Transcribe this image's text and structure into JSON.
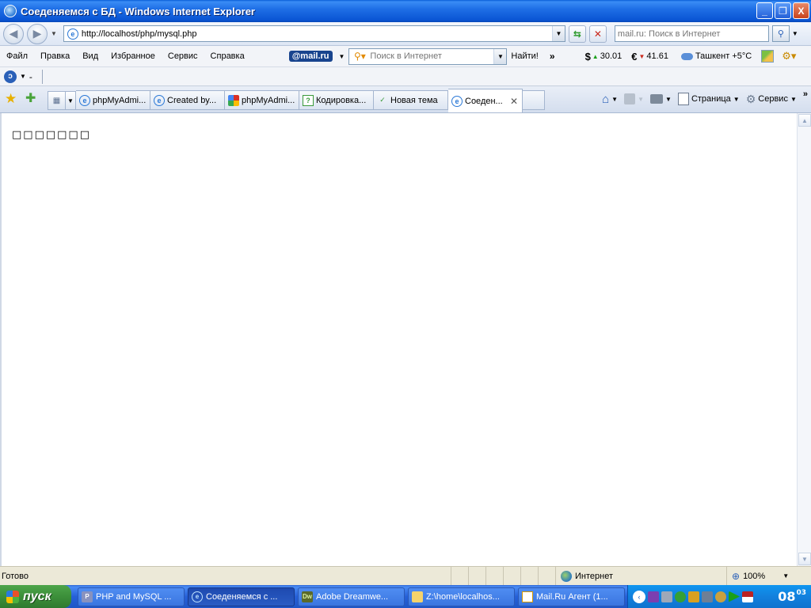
{
  "window": {
    "title": "Соеденяемся с БД - Windows Internet Explorer",
    "buttons": {
      "minimize": "_",
      "maximize": "❐",
      "close": "X"
    }
  },
  "addressbar": {
    "url": "http://localhost/php/mysql.php",
    "search_placeholder": "mail.ru: Поиск в Интернет"
  },
  "menu": {
    "items": [
      "Файл",
      "Правка",
      "Вид",
      "Избранное",
      "Сервис",
      "Справка"
    ]
  },
  "mailru": {
    "logo": "@mail.ru",
    "search_placeholder": "Поиск в Интернет",
    "find_label": "Найти!",
    "more": "»",
    "rates": [
      {
        "symbol": "$",
        "trend": "up",
        "value": "30.01"
      },
      {
        "symbol": "€",
        "trend": "down",
        "value": "41.61"
      }
    ],
    "weather": "Ташкент +5°C"
  },
  "links": {
    "dash": "-"
  },
  "tabs": [
    {
      "label": "phpMyAdmi...",
      "icon": "ie-icon"
    },
    {
      "label": "Created by...",
      "icon": "ie-icon"
    },
    {
      "label": "phpMyAdmi...",
      "icon": "google-icon"
    },
    {
      "label": "Кодировка...",
      "icon": "help-icon"
    },
    {
      "label": "Новая тема",
      "icon": "check-icon"
    },
    {
      "label": "Соеден...",
      "icon": "ie-icon",
      "active": true
    }
  ],
  "commandbar": {
    "page_label": "Страница",
    "tools_label": "Сервис",
    "more": "»"
  },
  "content": {
    "text": "□□□□□□□"
  },
  "status": {
    "text": "Готово",
    "zone": "Интернет",
    "zoom": "100%"
  },
  "taskbar": {
    "start_label": "пуск",
    "tasks": [
      {
        "label": "PHP and MySQL ...",
        "icon": "php-icon"
      },
      {
        "label": "Соеденяемся с ...",
        "icon": "ie-icon",
        "active": true
      },
      {
        "label": "Adobe Dreamwe...",
        "icon": "dreamweaver-icon"
      },
      {
        "label": "Z:\\home\\localhos...",
        "icon": "folder-icon"
      },
      {
        "label": "Mail.Ru Агент (1...",
        "icon": "mail-agent-icon"
      }
    ],
    "clock_hours": "08",
    "clock_minutes": "03"
  }
}
